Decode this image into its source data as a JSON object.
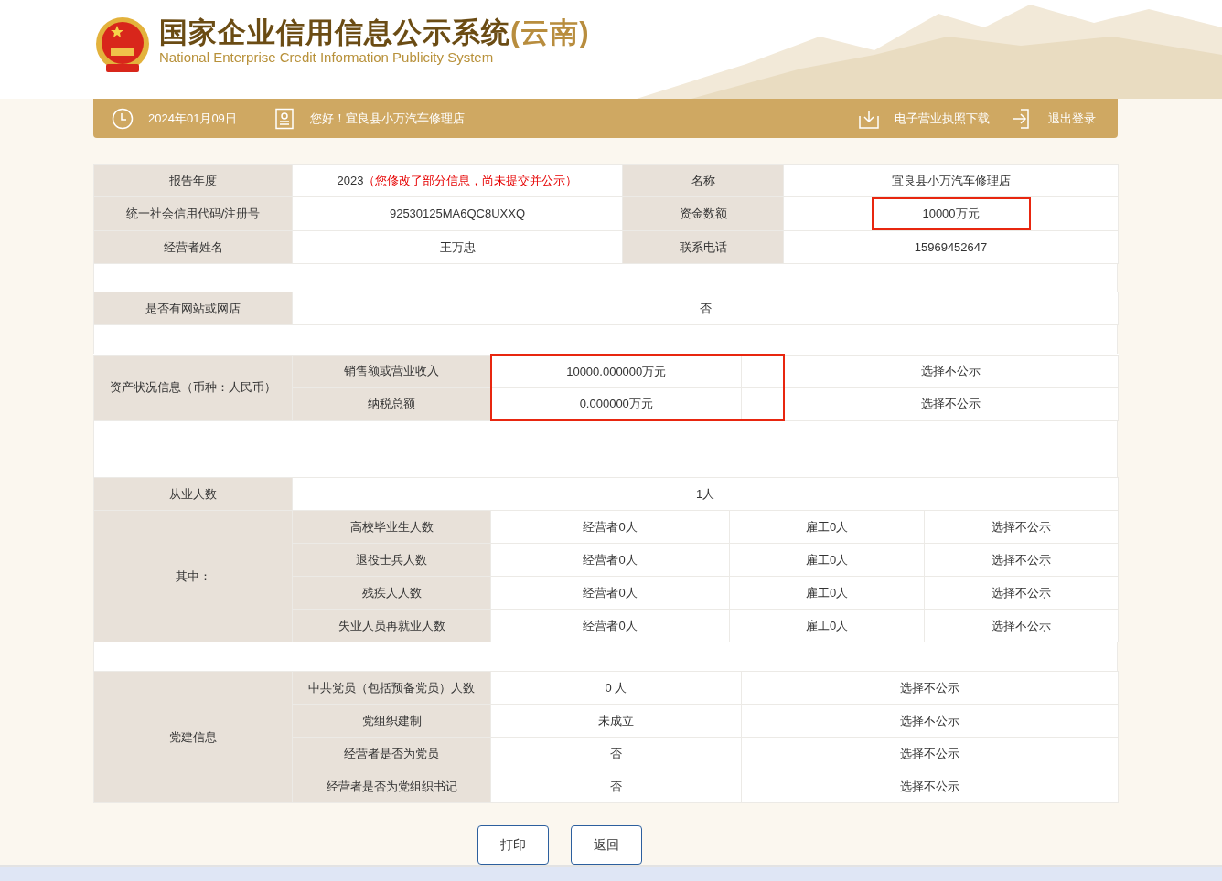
{
  "header": {
    "title": "国家企业信用信息公示系统",
    "region": "(云南)",
    "subtitle": "National Enterprise Credit Information Publicity System"
  },
  "top_bar": {
    "date": "2024年01月09日",
    "greeting": "您好！宜良县小万汽车修理店",
    "actions": [
      {
        "kind": "download",
        "label": "电子营业执照下载"
      },
      {
        "kind": "logout",
        "label": "退出登录"
      }
    ]
  },
  "basic_info": [
    {
      "label": "报告年度",
      "value": "2023",
      "note": "（您修改了部分信息，尚未提交并公示）",
      "highlighted": false
    },
    {
      "label": "名称",
      "value": "宜良县小万汽车修理店",
      "highlighted": false
    },
    {
      "label": "统一社会信用代码/注册号",
      "value": "92530125MA6QC8UXXQ",
      "highlighted": false
    },
    {
      "label": "资金数额",
      "value": "10000万元",
      "highlighted": true
    },
    {
      "label": "经营者姓名",
      "value": "王万忠",
      "highlighted": false
    },
    {
      "label": "联系电话",
      "value": "15969452647",
      "highlighted": false
    }
  ],
  "website": {
    "label": "是否有网站或网店",
    "value": "否"
  },
  "assets": {
    "label": "资产状况信息（币种：人民币）",
    "rows": [
      {
        "label": "销售额或营业收入",
        "value": "10000.000000万元",
        "disclosure": "选择不公示",
        "highlighted": true
      },
      {
        "label": "纳税总额",
        "value": "0.000000万元",
        "disclosure": "选择不公示",
        "highlighted": true
      }
    ]
  },
  "employment": {
    "total_label": "从业人数",
    "total_value": "1人",
    "breakdown_label": "其中：",
    "rows": [
      {
        "label": "高校毕业生人数",
        "operators": "经营者0人",
        "employees": "雇工0人",
        "disclosure": "选择不公示"
      },
      {
        "label": "退役士兵人数",
        "operators": "经营者0人",
        "employees": "雇工0人",
        "disclosure": "选择不公示"
      },
      {
        "label": "残疾人人数",
        "operators": "经营者0人",
        "employees": "雇工0人",
        "disclosure": "选择不公示"
      },
      {
        "label": "失业人员再就业人数",
        "operators": "经营者0人",
        "employees": "雇工0人",
        "disclosure": "选择不公示"
      }
    ]
  },
  "party": {
    "label": "党建信息",
    "rows": [
      {
        "label": "中共党员（包括预备党员）人数",
        "value": "0 人",
        "disclosure": "选择不公示"
      },
      {
        "label": "党组织建制",
        "value": "未成立",
        "disclosure": "选择不公示"
      },
      {
        "label": "经营者是否为党员",
        "value": "否",
        "disclosure": "选择不公示"
      },
      {
        "label": "经营者是否为党组织书记",
        "value": "否",
        "disclosure": "选择不公示"
      }
    ]
  },
  "buttons": [
    "打印",
    "返回"
  ]
}
